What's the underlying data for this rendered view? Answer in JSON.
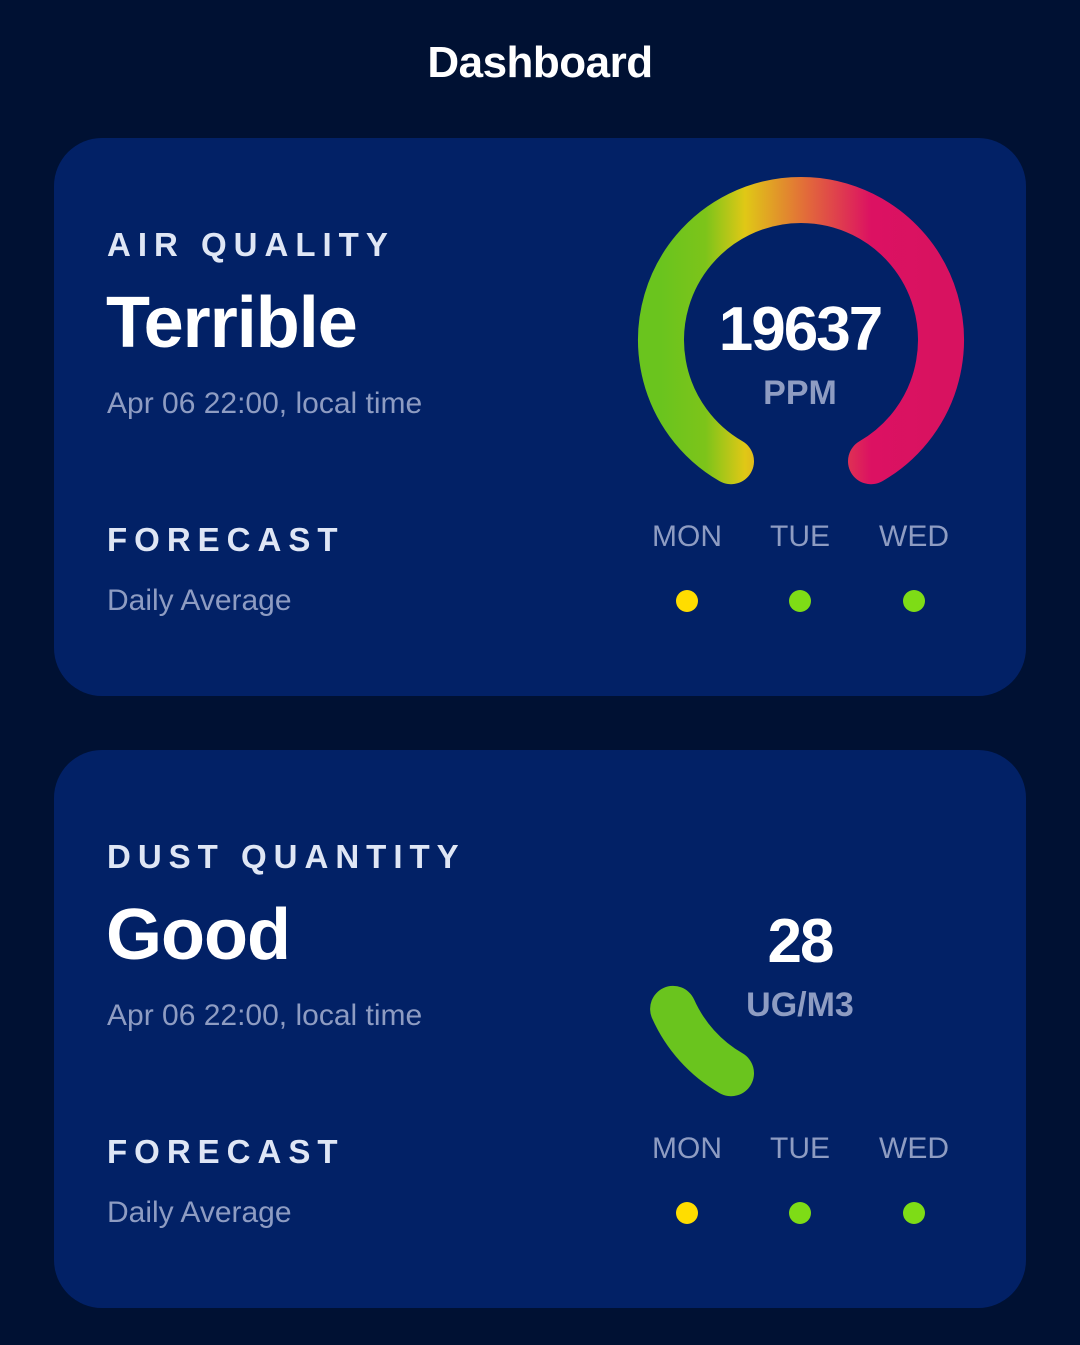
{
  "header": {
    "title": "Dashboard"
  },
  "air": {
    "label": "AIR QUALITY",
    "status": "Terrible",
    "timestamp": "Apr 06 22:00, local time",
    "gauge": {
      "value": "19637",
      "unit": "PPM",
      "fill_fraction": 1.0
    },
    "forecast": {
      "label": "FORECAST",
      "subtitle": "Daily Average",
      "days": [
        {
          "day": "MON",
          "color": "#ffdd00"
        },
        {
          "day": "TUE",
          "color": "#7edc16"
        },
        {
          "day": "WED",
          "color": "#7edc16"
        }
      ]
    }
  },
  "dust": {
    "label": "DUST QUANTITY",
    "status": "Good",
    "timestamp": "Apr 06 22:00, local time",
    "gauge": {
      "value": "28",
      "unit": "UG/M3",
      "fill_fraction": 0.12
    },
    "forecast": {
      "label": "FORECAST",
      "subtitle": "Daily Average",
      "days": [
        {
          "day": "MON",
          "color": "#ffdd00"
        },
        {
          "day": "TUE",
          "color": "#7edc16"
        },
        {
          "day": "WED",
          "color": "#7edc16"
        }
      ]
    }
  },
  "colors": {
    "background": "#001133",
    "card": "#022166",
    "gauge_good": "#6ac41e",
    "gauge_moderate": "#e6c914",
    "gauge_poor": "#e46a3a",
    "gauge_bad": "#dc1162"
  }
}
